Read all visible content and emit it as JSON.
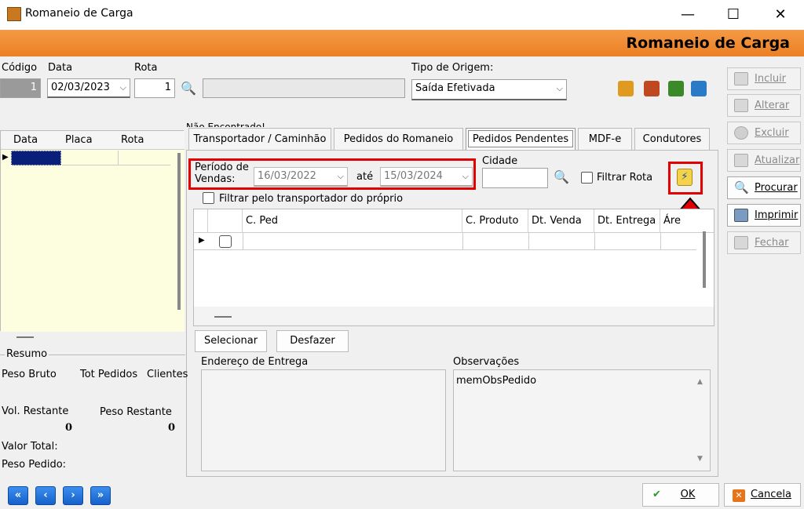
{
  "window": {
    "title": "Romaneio de Carga",
    "minimize": "—",
    "maximize": "☐",
    "close": "✕"
  },
  "header": {
    "title": "Romaneio de Carga"
  },
  "form": {
    "codigo_label": "Código",
    "codigo_value": "1",
    "data_label": "Data",
    "data_value": "02/03/2023",
    "rota_label": "Rota",
    "rota_value": "1",
    "tipo_origem_label": "Tipo de Origem:",
    "tipo_origem_value": "Saída Efetivada",
    "nao_encontrado": "Não Encontrado!"
  },
  "left_grid": {
    "columns": [
      "Data",
      "Placa",
      "Rota"
    ]
  },
  "tabs": [
    {
      "label": "Transportador / Caminhão"
    },
    {
      "label": "Pedidos do Romaneio"
    },
    {
      "label": "Pedidos Pendentes"
    },
    {
      "label": "MDF-e"
    },
    {
      "label": "Condutores"
    }
  ],
  "filter": {
    "periodo_label": "Período de Vendas:",
    "date_from": "16/03/2022",
    "ate_label": "até",
    "date_to": "15/03/2024",
    "cidade_label": "Cidade",
    "filtrar_rota_label": "Filtrar Rota",
    "filtrar_transportador_label": "Filtrar pelo transportador do próprio"
  },
  "orders_grid": {
    "columns": [
      "C. Ped",
      "C. Produto",
      "Dt. Venda",
      "Dt. Entrega",
      "Áre"
    ]
  },
  "actions": {
    "selecionar": "Selecionar",
    "desfazer": "Desfazer"
  },
  "resumo": {
    "title": "Resumo",
    "peso_bruto": "Peso Bruto",
    "tot_pedidos": "Tot Pedidos",
    "clientes": "Clientes",
    "vol_restante": "Vol. Restante",
    "peso_restante": "Peso Restante",
    "vol_value": "0",
    "peso_value": "0",
    "valor_total": "Valor Total:",
    "peso_pedido": "Peso Pedido:"
  },
  "endereco": {
    "label": "Endereço de Entrega"
  },
  "observacoes": {
    "label": "Observações",
    "value": "memObsPedido"
  },
  "side_buttons": [
    {
      "label": "Incluir"
    },
    {
      "label": "Alterar"
    },
    {
      "label": "Excluir"
    },
    {
      "label": "Atualizar"
    },
    {
      "label": "Procurar"
    },
    {
      "label": "Imprimir"
    },
    {
      "label": "Fechar"
    }
  ],
  "bottom": {
    "ok": "OK",
    "cancel": "Cancela"
  },
  "colors": {
    "header": "#ec8024",
    "highlight": "#e00000",
    "selected_cell": "#0a1f7a"
  }
}
